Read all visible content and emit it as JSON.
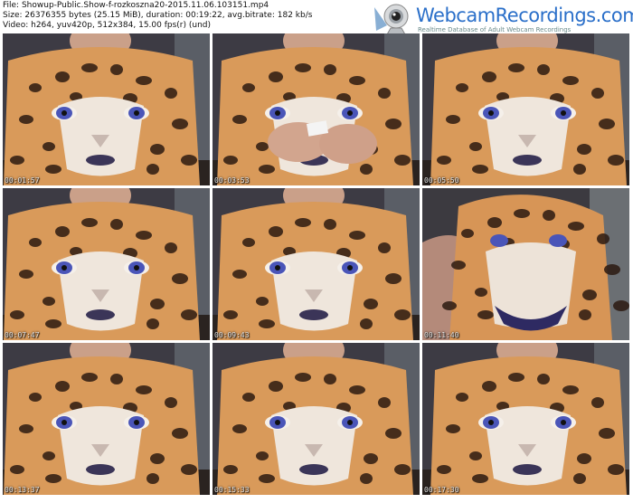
{
  "file_info": {
    "file_line": "File: Showup-Public.Show-f-rozkoszna20-2015.11.06.103151.mp4",
    "size_line": "Size: 26376355 bytes (25.15 MiB), duration: 00:19:22, avg.bitrate: 182 kb/s",
    "video_line": "Video: h264, yuv420p, 512x384, 15.00 fps(r) (und)"
  },
  "branding": {
    "site_name": "WebcamRecordings.com",
    "tagline": "Realtime Database of Adult Webcam Recordings",
    "logo_icon": "webcam-icon",
    "brand_color": "#2a6fc9"
  },
  "thumbnails": [
    {
      "timestamp": "00:01:57",
      "scene": "shirt"
    },
    {
      "timestamp": "00:03:53",
      "scene": "hands"
    },
    {
      "timestamp": "00:05:50",
      "scene": "shirt"
    },
    {
      "timestamp": "00:07:47",
      "scene": "shirt"
    },
    {
      "timestamp": "00:09:43",
      "scene": "shirt"
    },
    {
      "timestamp": "00:11:40",
      "scene": "leaning"
    },
    {
      "timestamp": "00:13:37",
      "scene": "shirt"
    },
    {
      "timestamp": "00:15:33",
      "scene": "shirt"
    },
    {
      "timestamp": "00:17:30",
      "scene": "shirt"
    }
  ]
}
